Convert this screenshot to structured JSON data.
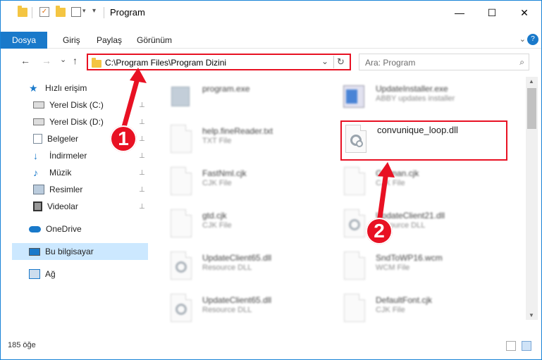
{
  "window": {
    "title": "Program",
    "minimize_glyph": "—",
    "maximize_glyph": "☐",
    "close_glyph": "✕"
  },
  "ribbon": {
    "file_tab": "Dosya",
    "tabs": [
      "Giriş",
      "Paylaş",
      "Görünüm"
    ],
    "expand_glyph": "⌄",
    "help_glyph": "?"
  },
  "address": {
    "path": "C:\\Program Files\\Program Dizini",
    "dropdown_glyph": "⌄",
    "refresh_glyph": "↻"
  },
  "search": {
    "placeholder": "Ara: Program",
    "icon_glyph": "⌕"
  },
  "nav_glyphs": {
    "back": "←",
    "forward": "→",
    "recent": "⌄",
    "up": "↑"
  },
  "navpane": {
    "quick_access": "Hızlı erişim",
    "items": [
      {
        "label": "Yerel Disk (C:)",
        "pinned": true
      },
      {
        "label": "Yerel Disk (D:)",
        "pinned": true
      },
      {
        "label": "Belgeler",
        "pinned": true
      },
      {
        "label": "İndirmeler",
        "pinned": true
      },
      {
        "label": "Müzik",
        "pinned": true
      },
      {
        "label": "Resimler",
        "pinned": true
      },
      {
        "label": "Videolar",
        "pinned": true
      }
    ],
    "onedrive": "OneDrive",
    "this_pc": "Bu bilgisayar",
    "network": "Ağ",
    "pin_glyph": "📌"
  },
  "files": {
    "left": [
      {
        "name": "program.exe",
        "desc": ""
      },
      {
        "name": "help.fineReader.txt",
        "desc": "TXT File"
      },
      {
        "name": "FastNml.cjk",
        "desc": "CJK File"
      },
      {
        "name": "gtd.cjk",
        "desc": "CJK File"
      },
      {
        "name": "UpdateClient65.dll",
        "desc": "Resource DLL"
      },
      {
        "name": "UpdateClient65.dll",
        "desc": "Resource DLL"
      }
    ],
    "right": [
      {
        "name": "UpdateInstaller.exe",
        "desc": "ABBY updates installer"
      },
      {
        "name": "convunique_loop.dll",
        "desc": ""
      },
      {
        "name": "German.cjk",
        "desc": "CJK File"
      },
      {
        "name": "UpdateClient21.dll",
        "desc": "Resource DLL"
      },
      {
        "name": "SndToWP16.wcm",
        "desc": "WCM File"
      },
      {
        "name": "DefaultFont.cjk",
        "desc": "CJK File"
      }
    ]
  },
  "status": {
    "item_count": "185 öğe"
  },
  "callouts": [
    "1",
    "2"
  ],
  "colors": {
    "accent": "#1979ca",
    "highlight": "#e81123",
    "folder": "#f4c542"
  }
}
